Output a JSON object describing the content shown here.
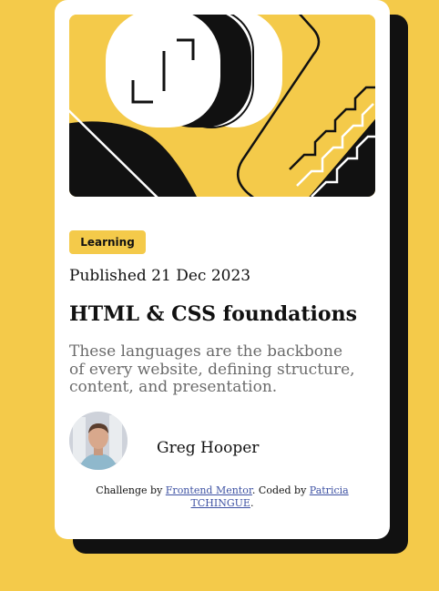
{
  "card": {
    "category": "Learning",
    "published": "Published 21 Dec 2023",
    "title": "HTML & CSS foundations",
    "description": "These languages are the backbone of every website, defining structure, content, and presentation.",
    "author": "Greg Hooper"
  },
  "attribution": {
    "prefix": "Challenge by",
    "link1": "Frontend Mentor",
    "middle": ". Coded by",
    "link2": "Patricia TCHINGUE",
    "suffix": "."
  },
  "colors": {
    "page_background": "#F4CA4A",
    "card_background": "#FFFFFF",
    "text": "#111111",
    "muted_text": "#6B6B6B",
    "shadow": "#111111",
    "badge": "#F4CA4A",
    "link": "#3E52A3"
  },
  "images": {
    "hero": "abstract-illustration",
    "avatar": "author-portrait"
  }
}
